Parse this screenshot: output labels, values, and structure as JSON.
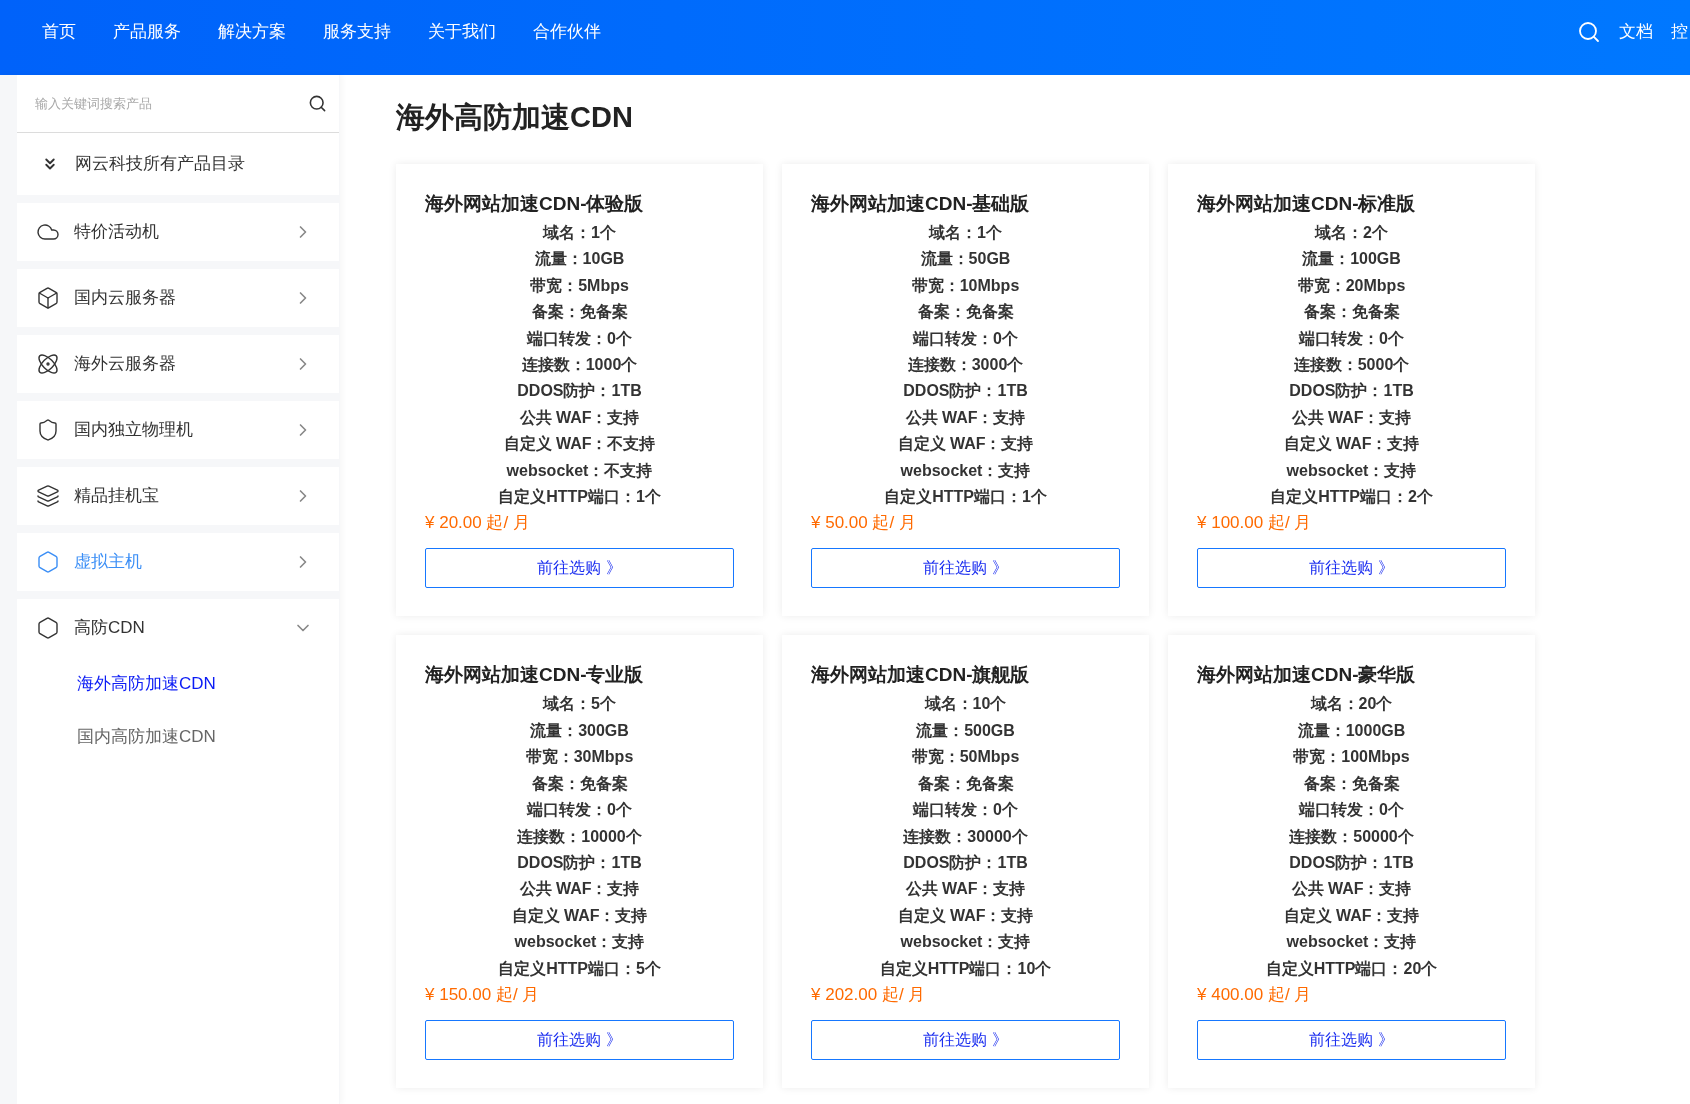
{
  "nav": {
    "items": [
      {
        "label": "首页"
      },
      {
        "label": "产品服务"
      },
      {
        "label": "解决方案"
      },
      {
        "label": "服务支持"
      },
      {
        "label": "关于我们"
      },
      {
        "label": "合作伙伴"
      }
    ],
    "right": [
      {
        "label": "文档"
      },
      {
        "label": "控"
      }
    ]
  },
  "sidebar": {
    "search": {
      "placeholder": "输入关键词搜索产品"
    },
    "catalog": "网云科技所有产品目录",
    "items": [
      {
        "label": "特价活动机",
        "selected": false,
        "expanded": false
      },
      {
        "label": "国内云服务器",
        "selected": false,
        "expanded": false
      },
      {
        "label": "海外云服务器",
        "selected": false,
        "expanded": false
      },
      {
        "label": "国内独立物理机",
        "selected": false,
        "expanded": false
      },
      {
        "label": "精品挂机宝",
        "selected": false,
        "expanded": false
      },
      {
        "label": "虚拟主机",
        "selected": true,
        "expanded": false
      },
      {
        "label": "高防CDN",
        "selected": false,
        "expanded": true,
        "children": [
          {
            "label": "海外高防加速CDN",
            "selected": true
          },
          {
            "label": "国内高防加速CDN",
            "selected": false
          }
        ]
      }
    ]
  },
  "page_title": "海外高防加速CDN",
  "cards": [
    {
      "title": "海外网站加速CDN-体验版",
      "specs": [
        "域名：1个",
        "流量：10GB",
        "带宽：5Mbps",
        "备案：免备案",
        "端口转发：0个",
        "连接数：1000个",
        "DDOS防护：1TB",
        "公共 WAF：支持",
        "自定义 WAF：不支持",
        "websocket：不支持",
        "自定义HTTP端口：1个"
      ],
      "price": "¥ 20.00 起/ 月",
      "button": "前往选购 》"
    },
    {
      "title": "海外网站加速CDN-基础版",
      "specs": [
        "域名：1个",
        "流量：50GB",
        "带宽：10Mbps",
        "备案：免备案",
        "端口转发：0个",
        "连接数：3000个",
        "DDOS防护：1TB",
        "公共 WAF：支持",
        "自定义 WAF：支持",
        "websocket：支持",
        "自定义HTTP端口：1个"
      ],
      "price": "¥ 50.00 起/ 月",
      "button": "前往选购 》"
    },
    {
      "title": "海外网站加速CDN-标准版",
      "specs": [
        "域名：2个",
        "流量：100GB",
        "带宽：20Mbps",
        "备案：免备案",
        "端口转发：0个",
        "连接数：5000个",
        "DDOS防护：1TB",
        "公共 WAF：支持",
        "自定义 WAF：支持",
        "websocket：支持",
        "自定义HTTP端口：2个"
      ],
      "price": "¥ 100.00 起/ 月",
      "button": "前往选购 》"
    },
    {
      "title": "海外网站加速CDN-专业版",
      "specs": [
        "域名：5个",
        "流量：300GB",
        "带宽：30Mbps",
        "备案：免备案",
        "端口转发：0个",
        "连接数：10000个",
        "DDOS防护：1TB",
        "公共 WAF：支持",
        "自定义 WAF：支持",
        "websocket：支持",
        "自定义HTTP端口：5个"
      ],
      "price": "¥ 150.00 起/ 月",
      "button": "前往选购 》"
    },
    {
      "title": "海外网站加速CDN-旗舰版",
      "specs": [
        "域名：10个",
        "流量：500GB",
        "带宽：50Mbps",
        "备案：免备案",
        "端口转发：0个",
        "连接数：30000个",
        "DDOS防护：1TB",
        "公共 WAF：支持",
        "自定义 WAF：支持",
        "websocket：支持",
        "自定义HTTP端口：10个"
      ],
      "price": "¥ 202.00 起/ 月",
      "button": "前往选购 》"
    },
    {
      "title": "海外网站加速CDN-豪华版",
      "specs": [
        "域名：20个",
        "流量：1000GB",
        "带宽：100Mbps",
        "备案：免备案",
        "端口转发：0个",
        "连接数：50000个",
        "DDOS防护：1TB",
        "公共 WAF：支持",
        "自定义 WAF：支持",
        "websocket：支持",
        "自定义HTTP端口：20个"
      ],
      "price": "¥ 400.00 起/ 月",
      "button": "前往选购 》"
    }
  ]
}
